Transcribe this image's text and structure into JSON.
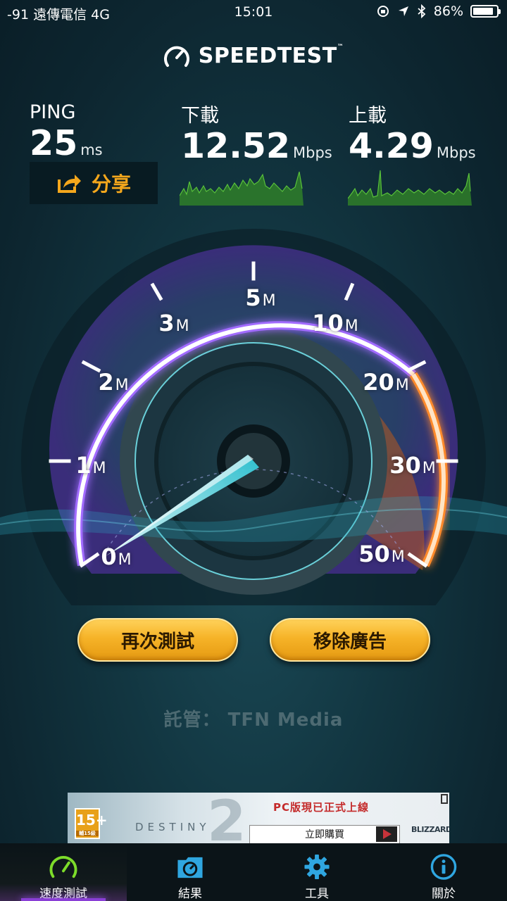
{
  "status_bar": {
    "carrier": "-91 遠傳電信   4G",
    "time": "15:01",
    "battery": "86%",
    "battery_level": 0.86
  },
  "header": {
    "logo_text": "SPEEDTEST",
    "trademark": "™"
  },
  "metrics": {
    "ping": {
      "label": "PING",
      "value": "25",
      "unit": "ms"
    },
    "download": {
      "label": "下載",
      "value": "12.52",
      "unit": "Mbps"
    },
    "upload": {
      "label": "上載",
      "value": "4.29",
      "unit": "Mbps"
    }
  },
  "share_button": {
    "label": "分享"
  },
  "gauge": {
    "ticks": [
      {
        "num": "0",
        "unit": "M"
      },
      {
        "num": "1",
        "unit": "M"
      },
      {
        "num": "2",
        "unit": "M"
      },
      {
        "num": "3",
        "unit": "M"
      },
      {
        "num": "5",
        "unit": "M"
      },
      {
        "num": "10",
        "unit": "M"
      },
      {
        "num": "20",
        "unit": "M"
      },
      {
        "num": "30",
        "unit": "M"
      },
      {
        "num": "50",
        "unit": "M"
      }
    ]
  },
  "buttons": {
    "retest": "再次測試",
    "remove_ads": "移除廣告"
  },
  "host": {
    "label": "託管： TFN Media"
  },
  "ad": {
    "rating": "15+",
    "rating_sub": "輔15級",
    "game": "DESTINY",
    "number": "2",
    "promo": "PC版現已正式上線",
    "buy": "立即購買",
    "publisher": "BLIZZARD"
  },
  "tabs": [
    {
      "label": "速度測試",
      "icon": "speedometer-icon",
      "active": true
    },
    {
      "label": "結果",
      "icon": "results-folder-icon",
      "active": false
    },
    {
      "label": "工具",
      "icon": "gear-icon",
      "active": false
    },
    {
      "label": "關於",
      "icon": "info-icon",
      "active": false
    }
  ],
  "colors": {
    "accent_orange": "#f4a71c",
    "gauge_purple": "#8a4fe0",
    "gauge_orange": "#ff8a2a",
    "tab_active": "#8a3fd6",
    "icon_blue": "#2fa6e0",
    "icon_green": "#7ddc2a"
  }
}
